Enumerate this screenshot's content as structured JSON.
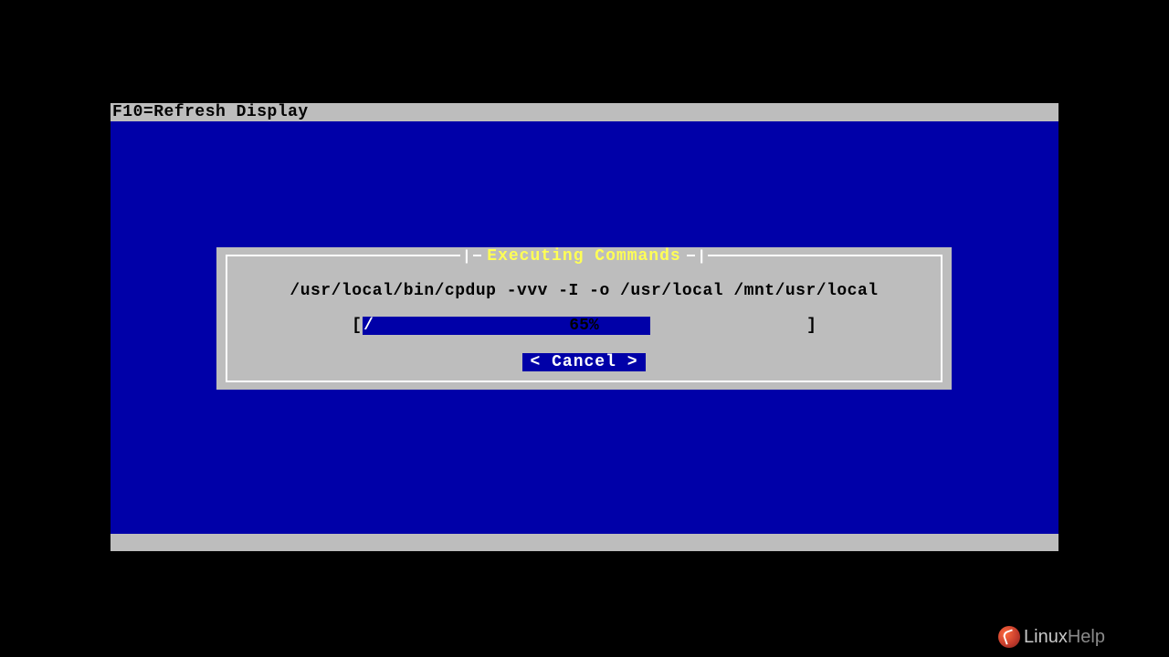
{
  "top_bar": {
    "hint": "F10=Refresh Display"
  },
  "dialog": {
    "title": "Executing Commands",
    "command": "/usr/local/bin/cpdup -vvv -I -o /usr/local /mnt/usr/local",
    "progress": {
      "percent": 65,
      "percent_label": "65%",
      "spinner": "/",
      "bracket_left": "[",
      "bracket_right": "]"
    },
    "cancel_label": "< Cancel >"
  },
  "branding": {
    "logo_linux": "Linux",
    "logo_help": "Help"
  }
}
